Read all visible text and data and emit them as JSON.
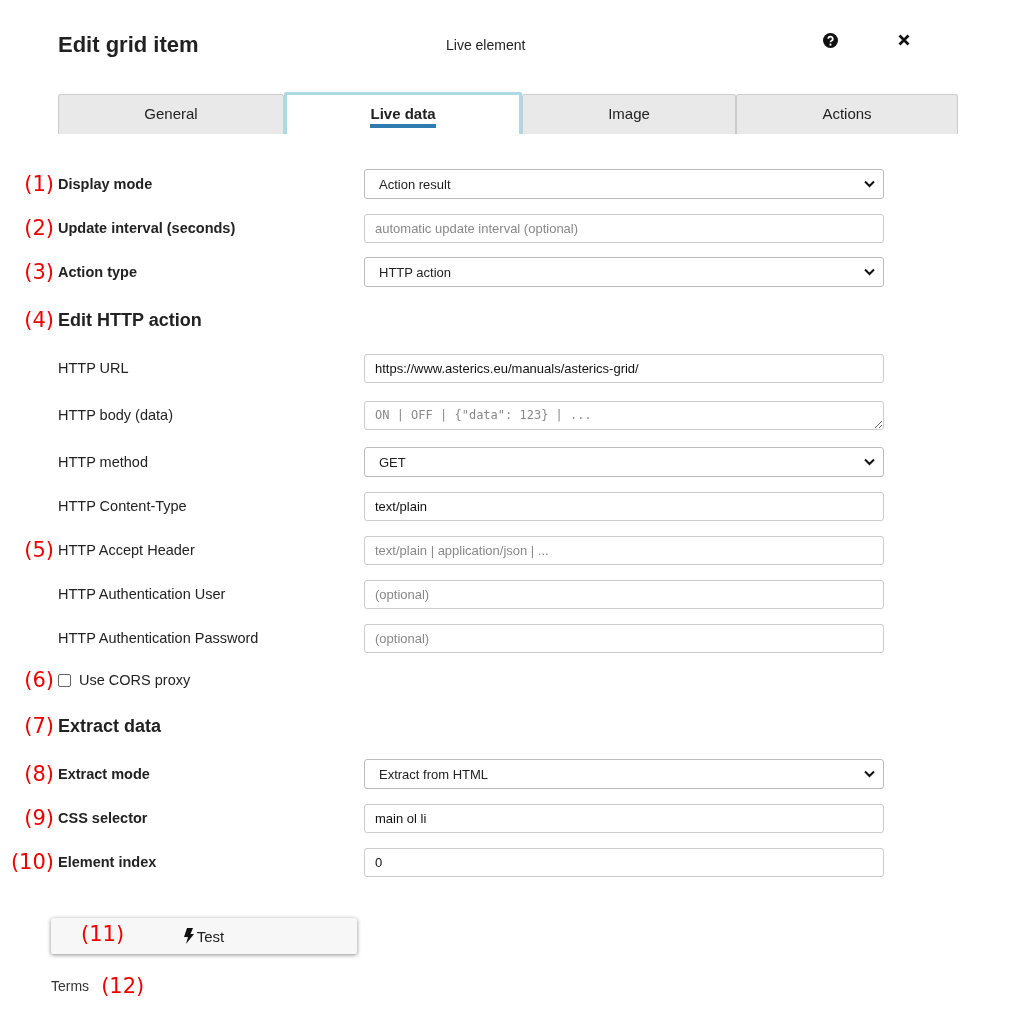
{
  "header": {
    "title": "Edit grid item",
    "subtitle": "Live element"
  },
  "tabs": [
    {
      "label": "General",
      "selected": false
    },
    {
      "label": "Live data",
      "selected": true
    },
    {
      "label": "Image",
      "selected": false
    },
    {
      "label": "Actions",
      "selected": false
    }
  ],
  "rows": [
    {
      "marker": "(1)",
      "kind": "select",
      "label": "Display mode",
      "bold": true,
      "value": "Action result"
    },
    {
      "marker": "(2)",
      "kind": "input",
      "label": "Update interval (seconds)",
      "bold": true,
      "placeholder": "automatic update interval (optional)"
    },
    {
      "marker": "(3)",
      "kind": "select",
      "label": "Action type",
      "bold": true,
      "value": "HTTP action"
    },
    {
      "marker": "(4)",
      "kind": "heading",
      "label": "Edit HTTP action"
    },
    {
      "kind": "input",
      "label": "HTTP URL",
      "bold": false,
      "value": "https://www.asterics.eu/manuals/asterics-grid/"
    },
    {
      "kind": "textarea",
      "label": "HTTP body (data)",
      "bold": false,
      "placeholder": "ON | OFF | {\"data\": 123} | ..."
    },
    {
      "kind": "select",
      "label": "HTTP method",
      "bold": false,
      "value": "GET"
    },
    {
      "kind": "input",
      "label": "HTTP Content-Type",
      "bold": false,
      "value": "text/plain"
    },
    {
      "marker": "(5)",
      "kind": "input",
      "label": "HTTP Accept Header",
      "bold": false,
      "placeholder": "text/plain | application/json | ..."
    },
    {
      "kind": "input",
      "label": "HTTP Authentication User",
      "bold": false,
      "placeholder": "(optional)"
    },
    {
      "kind": "input",
      "label": "HTTP Authentication Password",
      "bold": false,
      "placeholder": "(optional)"
    },
    {
      "marker": "(6)",
      "kind": "checkbox",
      "label": "Use CORS proxy",
      "checked": false
    },
    {
      "marker": "(7)",
      "kind": "heading",
      "label": "Extract data"
    },
    {
      "marker": "(8)",
      "kind": "select",
      "label": "Extract mode",
      "bold": true,
      "value": "Extract from HTML"
    },
    {
      "marker": "(9)",
      "kind": "input",
      "label": "CSS selector",
      "bold": true,
      "value": "main ol li"
    },
    {
      "marker": "(10)",
      "kind": "input",
      "label": "Element index",
      "bold": true,
      "value": "0"
    }
  ],
  "test_button": {
    "label": "Test",
    "marker": "(11)"
  },
  "footer": {
    "link": "Terms",
    "marker": "(12)"
  }
}
